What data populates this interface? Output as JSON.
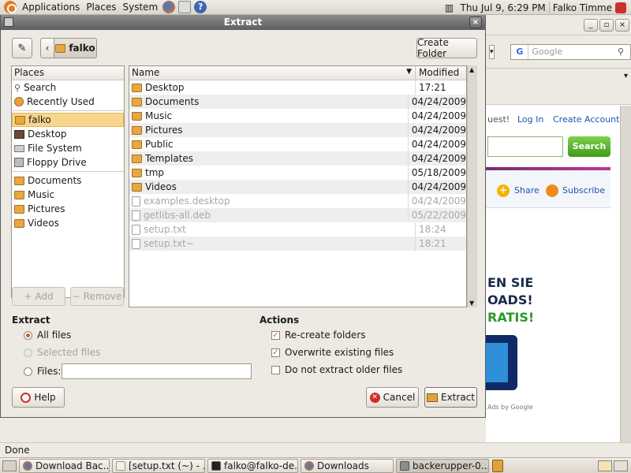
{
  "top_panel": {
    "menus": [
      "Applications",
      "Places",
      "System"
    ],
    "clock": "Thu Jul  9,  6:29 PM",
    "user": "Falko Timme"
  },
  "browser": {
    "search_placeholder": "Google",
    "links": {
      "login": "Log In",
      "create_account": "Create Account"
    },
    "partial_text": "uest!",
    "search_button": "Search",
    "share": "Share",
    "subscribe": "Subscribe",
    "ad_lines": [
      "EN SIE",
      "OADS!",
      "RATIS!"
    ],
    "ads_by": "Ads by Google",
    "status": "Done"
  },
  "dialog": {
    "title": "Extract",
    "location": "falko",
    "create_folder": "Create Folder",
    "places_header": "Places",
    "places": [
      {
        "label": "Search",
        "icon": "search-icon"
      },
      {
        "label": "Recently Used",
        "icon": "recent-icon"
      }
    ],
    "devices": [
      {
        "label": "falko",
        "icon": "home-folder-icon",
        "selected": true
      },
      {
        "label": "Desktop",
        "icon": "desktop-icon"
      },
      {
        "label": "File System",
        "icon": "harddisk-icon"
      },
      {
        "label": "Floppy Drive",
        "icon": "floppy-icon"
      }
    ],
    "bookmarks": [
      {
        "label": "Documents"
      },
      {
        "label": "Music"
      },
      {
        "label": "Pictures"
      },
      {
        "label": "Videos"
      }
    ],
    "add_button": "Add",
    "remove_button": "Remove",
    "columns": {
      "name": "Name",
      "modified": "Modified"
    },
    "files": [
      {
        "name": "Desktop",
        "modified": "17:21",
        "type": "folder"
      },
      {
        "name": "Documents",
        "modified": "04/24/2009",
        "type": "folder"
      },
      {
        "name": "Music",
        "modified": "04/24/2009",
        "type": "folder"
      },
      {
        "name": "Pictures",
        "modified": "04/24/2009",
        "type": "folder"
      },
      {
        "name": "Public",
        "modified": "04/24/2009",
        "type": "folder"
      },
      {
        "name": "Templates",
        "modified": "04/24/2009",
        "type": "folder"
      },
      {
        "name": "tmp",
        "modified": "05/18/2009",
        "type": "folder"
      },
      {
        "name": "Videos",
        "modified": "04/24/2009",
        "type": "folder"
      },
      {
        "name": "examples.desktop",
        "modified": "04/24/2009",
        "type": "file"
      },
      {
        "name": "getlibs-all.deb",
        "modified": "05/22/2009",
        "type": "file"
      },
      {
        "name": "setup.txt",
        "modified": "18:24",
        "type": "file"
      },
      {
        "name": "setup.txt~",
        "modified": "18:21",
        "type": "file"
      }
    ],
    "extract_header": "Extract",
    "all_files": "All files",
    "selected_files": "Selected files",
    "files_label": "Files:",
    "files_value": "",
    "actions_header": "Actions",
    "recreate_folders": "Re-create folders",
    "overwrite": "Overwrite existing files",
    "no_older": "Do not extract older files",
    "help": "Help",
    "cancel": "Cancel",
    "extract": "Extract"
  },
  "taskbar": {
    "tasks": [
      "Download Bac...",
      "[setup.txt (~) - ...",
      "falko@falko-de...",
      "Downloads",
      "backerupper-0...."
    ]
  }
}
